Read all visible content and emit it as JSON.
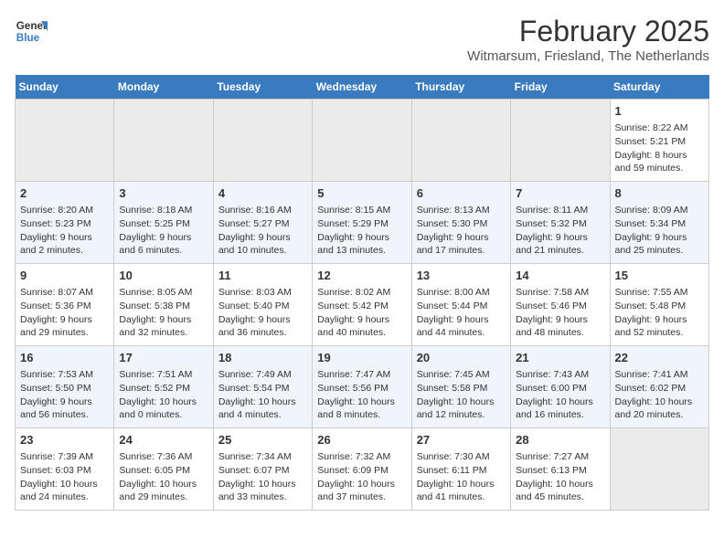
{
  "logo": {
    "line1": "General",
    "line2": "Blue"
  },
  "title": "February 2025",
  "subtitle": "Witmarsum, Friesland, The Netherlands",
  "weekdays": [
    "Sunday",
    "Monday",
    "Tuesday",
    "Wednesday",
    "Thursday",
    "Friday",
    "Saturday"
  ],
  "weeks": [
    [
      {
        "day": "",
        "info": "",
        "empty": true
      },
      {
        "day": "",
        "info": "",
        "empty": true
      },
      {
        "day": "",
        "info": "",
        "empty": true
      },
      {
        "day": "",
        "info": "",
        "empty": true
      },
      {
        "day": "",
        "info": "",
        "empty": true
      },
      {
        "day": "",
        "info": "",
        "empty": true
      },
      {
        "day": "1",
        "info": "Sunrise: 8:22 AM\nSunset: 5:21 PM\nDaylight: 8 hours and 59 minutes.",
        "empty": false
      }
    ],
    [
      {
        "day": "2",
        "info": "Sunrise: 8:20 AM\nSunset: 5:23 PM\nDaylight: 9 hours and 2 minutes.",
        "empty": false
      },
      {
        "day": "3",
        "info": "Sunrise: 8:18 AM\nSunset: 5:25 PM\nDaylight: 9 hours and 6 minutes.",
        "empty": false
      },
      {
        "day": "4",
        "info": "Sunrise: 8:16 AM\nSunset: 5:27 PM\nDaylight: 9 hours and 10 minutes.",
        "empty": false
      },
      {
        "day": "5",
        "info": "Sunrise: 8:15 AM\nSunset: 5:29 PM\nDaylight: 9 hours and 13 minutes.",
        "empty": false
      },
      {
        "day": "6",
        "info": "Sunrise: 8:13 AM\nSunset: 5:30 PM\nDaylight: 9 hours and 17 minutes.",
        "empty": false
      },
      {
        "day": "7",
        "info": "Sunrise: 8:11 AM\nSunset: 5:32 PM\nDaylight: 9 hours and 21 minutes.",
        "empty": false
      },
      {
        "day": "8",
        "info": "Sunrise: 8:09 AM\nSunset: 5:34 PM\nDaylight: 9 hours and 25 minutes.",
        "empty": false
      }
    ],
    [
      {
        "day": "9",
        "info": "Sunrise: 8:07 AM\nSunset: 5:36 PM\nDaylight: 9 hours and 29 minutes.",
        "empty": false
      },
      {
        "day": "10",
        "info": "Sunrise: 8:05 AM\nSunset: 5:38 PM\nDaylight: 9 hours and 32 minutes.",
        "empty": false
      },
      {
        "day": "11",
        "info": "Sunrise: 8:03 AM\nSunset: 5:40 PM\nDaylight: 9 hours and 36 minutes.",
        "empty": false
      },
      {
        "day": "12",
        "info": "Sunrise: 8:02 AM\nSunset: 5:42 PM\nDaylight: 9 hours and 40 minutes.",
        "empty": false
      },
      {
        "day": "13",
        "info": "Sunrise: 8:00 AM\nSunset: 5:44 PM\nDaylight: 9 hours and 44 minutes.",
        "empty": false
      },
      {
        "day": "14",
        "info": "Sunrise: 7:58 AM\nSunset: 5:46 PM\nDaylight: 9 hours and 48 minutes.",
        "empty": false
      },
      {
        "day": "15",
        "info": "Sunrise: 7:55 AM\nSunset: 5:48 PM\nDaylight: 9 hours and 52 minutes.",
        "empty": false
      }
    ],
    [
      {
        "day": "16",
        "info": "Sunrise: 7:53 AM\nSunset: 5:50 PM\nDaylight: 9 hours and 56 minutes.",
        "empty": false
      },
      {
        "day": "17",
        "info": "Sunrise: 7:51 AM\nSunset: 5:52 PM\nDaylight: 10 hours and 0 minutes.",
        "empty": false
      },
      {
        "day": "18",
        "info": "Sunrise: 7:49 AM\nSunset: 5:54 PM\nDaylight: 10 hours and 4 minutes.",
        "empty": false
      },
      {
        "day": "19",
        "info": "Sunrise: 7:47 AM\nSunset: 5:56 PM\nDaylight: 10 hours and 8 minutes.",
        "empty": false
      },
      {
        "day": "20",
        "info": "Sunrise: 7:45 AM\nSunset: 5:58 PM\nDaylight: 10 hours and 12 minutes.",
        "empty": false
      },
      {
        "day": "21",
        "info": "Sunrise: 7:43 AM\nSunset: 6:00 PM\nDaylight: 10 hours and 16 minutes.",
        "empty": false
      },
      {
        "day": "22",
        "info": "Sunrise: 7:41 AM\nSunset: 6:02 PM\nDaylight: 10 hours and 20 minutes.",
        "empty": false
      }
    ],
    [
      {
        "day": "23",
        "info": "Sunrise: 7:39 AM\nSunset: 6:03 PM\nDaylight: 10 hours and 24 minutes.",
        "empty": false
      },
      {
        "day": "24",
        "info": "Sunrise: 7:36 AM\nSunset: 6:05 PM\nDaylight: 10 hours and 29 minutes.",
        "empty": false
      },
      {
        "day": "25",
        "info": "Sunrise: 7:34 AM\nSunset: 6:07 PM\nDaylight: 10 hours and 33 minutes.",
        "empty": false
      },
      {
        "day": "26",
        "info": "Sunrise: 7:32 AM\nSunset: 6:09 PM\nDaylight: 10 hours and 37 minutes.",
        "empty": false
      },
      {
        "day": "27",
        "info": "Sunrise: 7:30 AM\nSunset: 6:11 PM\nDaylight: 10 hours and 41 minutes.",
        "empty": false
      },
      {
        "day": "28",
        "info": "Sunrise: 7:27 AM\nSunset: 6:13 PM\nDaylight: 10 hours and 45 minutes.",
        "empty": false
      },
      {
        "day": "",
        "info": "",
        "empty": true
      }
    ]
  ]
}
